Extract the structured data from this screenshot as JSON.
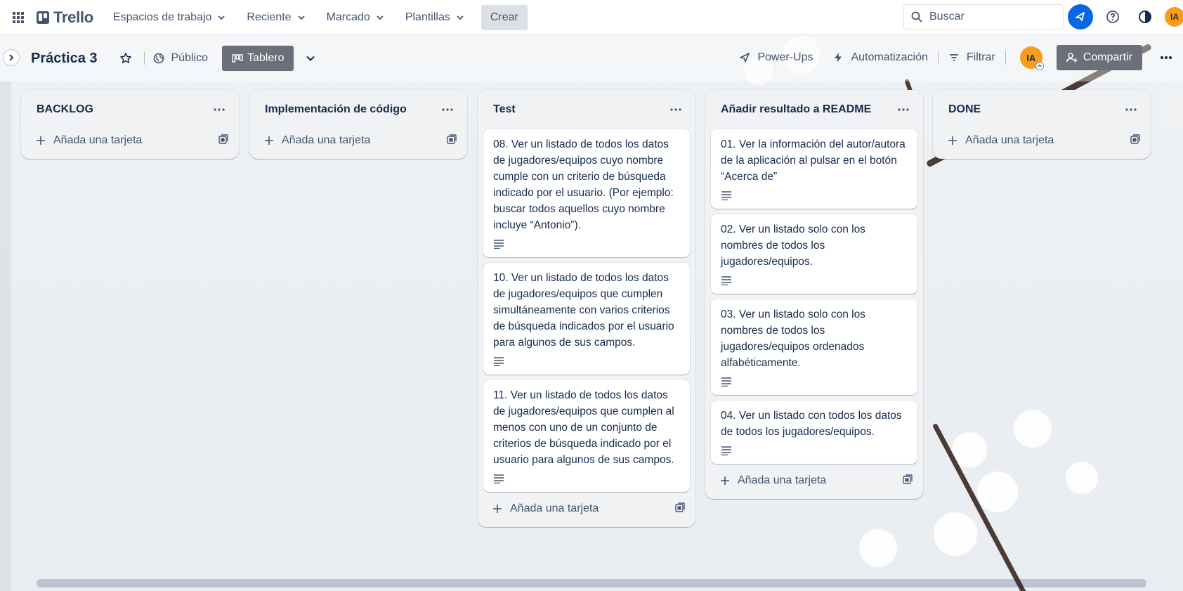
{
  "topbar": {
    "logo": "Trello",
    "nav": [
      {
        "label": "Espacios de trabajo"
      },
      {
        "label": "Reciente"
      },
      {
        "label": "Marcado"
      },
      {
        "label": "Plantillas"
      }
    ],
    "create": "Crear",
    "search_placeholder": "Buscar",
    "user_initials": "IA",
    "icons": [
      "apps-grid-icon",
      "rocket-icon",
      "help-icon",
      "theme-icon"
    ]
  },
  "board": {
    "title": "Práctica 3",
    "visibility": "Público",
    "view": "Tablero",
    "actions": {
      "powerups": "Power-Ups",
      "automation": "Automatización",
      "filter": "Filtrar",
      "share": "Compartir"
    },
    "member_initials": "IA"
  },
  "add_card_label": "Añada una tarjeta",
  "lists": [
    {
      "title": "BACKLOG",
      "cards": []
    },
    {
      "title": "Implementación de código",
      "cards": []
    },
    {
      "title": "Test",
      "cards": [
        {
          "text": "08. Ver un listado de todos los datos de jugadores/equipos cuyo nombre cumple con un criterio de búsqueda indicado por el usuario. (Por ejemplo: buscar todos aquellos cuyo nombre incluye “Antonio”)."
        },
        {
          "text": "10. Ver un listado de todos los datos de jugadores/equipos que cumplen simultáneamente con varios criterios de búsqueda indicados por el usuario para algunos de sus campos."
        },
        {
          "text": "11. Ver un listado de todos los datos de jugadores/equipos que cumplen al menos con uno de un conjunto de criterios de búsqueda indicado por el usuario para algunos de sus campos."
        }
      ]
    },
    {
      "title": "Añadir resultado a README",
      "cards": [
        {
          "text": "01. Ver la información del autor/autora de la aplicación al pulsar en el botón “Acerca de”"
        },
        {
          "text": "02. Ver un listado solo con los nombres de todos los jugadores/equipos."
        },
        {
          "text": "03. Ver un listado solo con los nombres de todos los jugadores/equipos ordenados alfabéticamente."
        },
        {
          "text": "04. Ver un listado con todos los datos de todos los jugadores/equipos."
        }
      ]
    },
    {
      "title": "DONE",
      "cards": []
    }
  ],
  "colors": {
    "accent_blue": "#0c66e4",
    "avatar_orange": "#f79e1b",
    "list_bg": "#f1f2f4",
    "button_gray": "#6b7078"
  }
}
